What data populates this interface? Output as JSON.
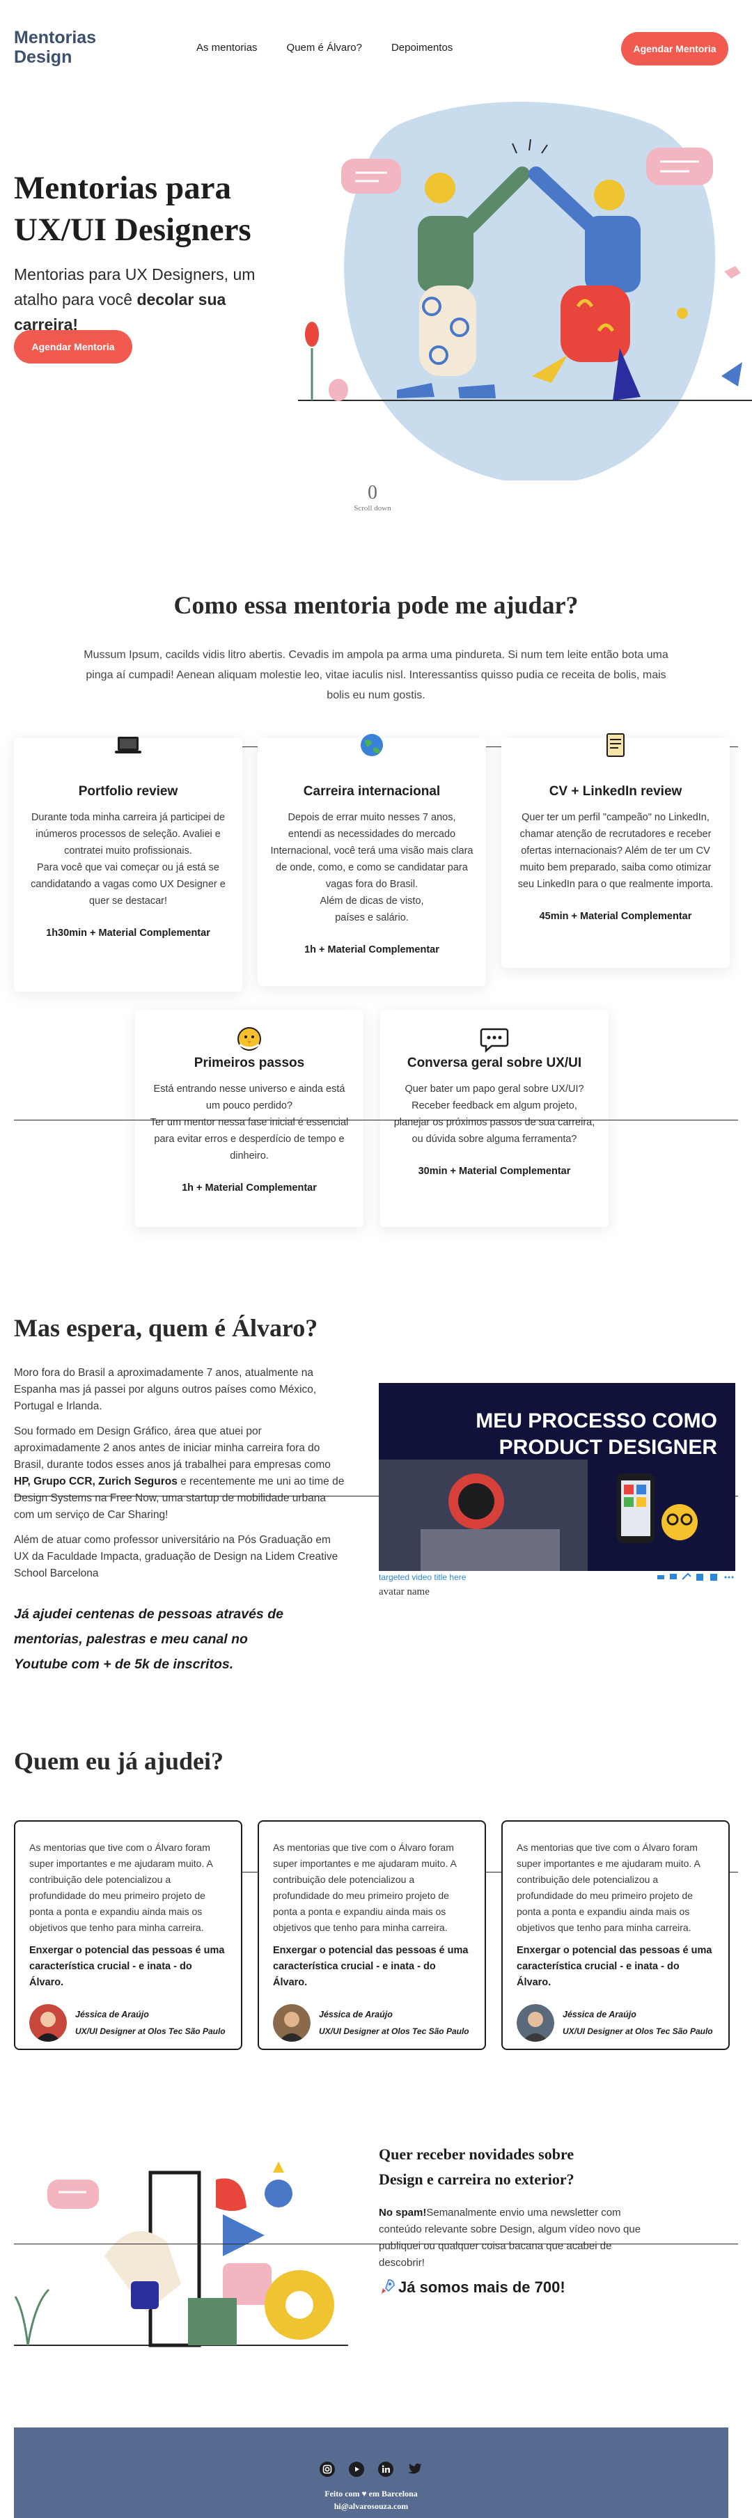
{
  "header": {
    "logo": "Mentorias Design",
    "nav": [
      "As mentorias",
      "Quem é Álvaro?",
      "Depoimentos"
    ],
    "cta": "Agendar Mentoria"
  },
  "hero": {
    "title": "Mentorias para UX/UI Designers",
    "subtitle_plain": "Mentorias para UX Designers, um atalho para você ",
    "subtitle_bold": "decolar sua carreira!",
    "cta": "Agendar Mentoria",
    "scroll_counter": "0",
    "scroll_label": "Scroll down"
  },
  "help": {
    "title": "Como essa mentoria pode me ajudar?",
    "intro": "Mussum Ipsum, cacilds vidis litro abertis. Cevadis im ampola pa arma uma pindureta. Si num tem leite então bota uma pinga aí cumpadi! Aenean aliquam molestie leo, vitae iaculis nisl. Interessantiss quisso pudia ce receita de bolis, mais bolis eu num gostis.",
    "cards": [
      {
        "icon": "laptop-icon",
        "title": "Portfolio review",
        "text": "Durante toda minha carreira já participei de inúmeros processos de seleção. Avaliei e contratei muito profissionais.\nPara você que vai começar ou já está se candidatando a vagas como UX Designer e quer se destacar!",
        "duration": "1h30min + Material Complementar"
      },
      {
        "icon": "globe-icon",
        "title": "Carreira internacional",
        "text": "Depois de errar muito nesses 7 anos, entendi as necessidades do mercado Internacional, você terá uma visão mais clara de onde, como, e como se candidatar para vagas fora do Brasil.\nAlém de dicas de visto,\npaíses e salário.",
        "duration": "1h + Material Complementar"
      },
      {
        "icon": "document-icon",
        "title": "CV + LinkedIn review",
        "text": "Quer ter um perfil \"campeão\" no LinkedIn, chamar atenção de recrutadores e receber ofertas internacionais? Além de ter um CV muito bem preparado, saiba como otimizar seu LinkedIn para o que realmente importa.",
        "duration": "45min + Material Complementar"
      },
      {
        "icon": "chick-icon",
        "title": "Primeiros passos",
        "text": "Está entrando nesse universo e ainda está um pouco perdido?\nTer um mentor nessa fase inicial é essencial para evitar erros e desperdício de tempo e dinheiro.",
        "duration": "1h + Material Complementar"
      },
      {
        "icon": "chat-bubble-icon",
        "title": "Conversa geral sobre UX/UI",
        "text": "Quer bater um papo geral sobre UX/UI?\nReceber feedback em algum projeto, planejar os próximos passos de sua carreira, ou dúvida sobre alguma ferramenta?",
        "duration": "30min + Material Complementar"
      }
    ]
  },
  "about": {
    "title": "Mas espera, quem é Álvaro?",
    "p1": "Moro fora do Brasil a aproximadamente 7 anos, atualmente na Espanha mas já passei por alguns outros países como México, Portugal e Irlanda.",
    "p2_a": "Sou formado em Design Gráfico, área que atuei por aproximadamente 2 anos antes de iniciar minha carreira fora do Brasil, durante todos esses anos já trabalhei para empresas como ",
    "p2_b": "HP, Grupo CCR, Zurich Seguros",
    "p2_c": " e recentemente me uni ao time de Design Systems na Free Now, uma startup de mobilidade urbana com um serviço de Car Sharing!",
    "p3": "Além de atuar como professor universitário na Pós Graduação em UX da Faculdade Impacta, graduação de Design na Lidem Creative School Barcelona",
    "quote": "Já ajudei centenas de pessoas através de mentorias, palestras e meu canal no Youtube com + de 5k de inscritos.",
    "video_title_line1": "MEU PROCESSO COMO",
    "video_title_line2": "PRODUCT DESIGNER",
    "video_link": "targeted video title here",
    "video_avatar": "avatar name"
  },
  "testimonials": {
    "title": "Quem eu já ajudei?",
    "items": [
      {
        "text": "As mentorias que tive com o Álvaro foram super importantes e me ajudaram muito. A contribuição dele potencializou a profundidade do meu primeiro projeto de ponta a ponta e expandiu ainda mais os objetivos que tenho para minha carreira.",
        "highlight": "Enxergar o potencial das pessoas é uma característica crucial - e inata - do Álvaro.",
        "name": "Jéssica de Araújo",
        "role": "UX/UI Designer at Olos Tec São Paulo",
        "avatar_color": "#c8473c"
      },
      {
        "text": "As mentorias que tive com o Álvaro foram super importantes e me ajudaram muito. A contribuição dele potencializou a profundidade do meu primeiro projeto de ponta a ponta e expandiu ainda mais os objetivos que tenho para minha carreira.",
        "highlight": "Enxergar o potencial das pessoas é uma característica crucial - e inata - do Álvaro.",
        "name": "Jéssica de Araújo",
        "role": "UX/UI Designer at Olos Tec São Paulo",
        "avatar_color": "#8a6a4a"
      },
      {
        "text": "As mentorias que tive com o Álvaro foram super importantes e me ajudaram muito. A contribuição dele potencializou a profundidade do meu primeiro projeto de ponta a ponta e expandiu ainda mais os objetivos que tenho para minha carreira.",
        "highlight": "Enxergar o potencial das pessoas é uma característica crucial - e inata - do Álvaro.",
        "name": "Jéssica de Araújo",
        "role": "UX/UI Designer at Olos Tec São Paulo",
        "avatar_color": "#5a6a7a"
      }
    ]
  },
  "newsletter": {
    "title": "Quer receber novidades sobre Design e carreira no exterior?",
    "text_bold": "No spam!",
    "text": "Semanalmente envio uma newsletter com conteúdo relevante sobre Design, algum vídeo novo que publiquei ou qualquer coisa bacana que acabei de descobrir!",
    "count": "Já somos mais de 700!"
  },
  "footer": {
    "socials": [
      "instagram-icon",
      "youtube-icon",
      "linkedin-icon",
      "twitter-icon"
    ],
    "line1": "Feito com ♥ em Barcelona",
    "line2": "hi@alvarosouza.com"
  },
  "colors": {
    "accent": "#f05a4f",
    "footer": "#566b8f",
    "hero_blob": "#c9dcee"
  }
}
